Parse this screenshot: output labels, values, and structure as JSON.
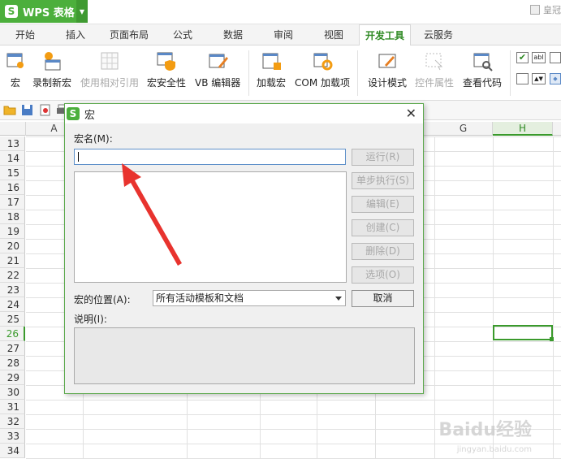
{
  "app": {
    "logo_letter": "S",
    "title": "WPS 表格",
    "user_label": "皇冠"
  },
  "tabs": [
    {
      "label": "开始"
    },
    {
      "label": "插入"
    },
    {
      "label": "页面布局"
    },
    {
      "label": "公式"
    },
    {
      "label": "数据"
    },
    {
      "label": "审阅"
    },
    {
      "label": "视图"
    },
    {
      "label": "开发工具",
      "active": true
    },
    {
      "label": "云服务"
    }
  ],
  "ribbon": {
    "macro": "宏",
    "record_macro": "录制新宏",
    "relative_ref": "使用相对引用",
    "macro_security": "宏安全性",
    "vb_editor": "VB 编辑器",
    "load_macro": "加载宏",
    "com_addins": "COM 加载项",
    "design_mode": "设计模式",
    "control_props": "控件属性",
    "view_code": "查看代码"
  },
  "sheet": {
    "columns": [
      "A",
      "G",
      "H"
    ],
    "rows": [
      "13",
      "14",
      "15",
      "16",
      "17",
      "18",
      "19",
      "20",
      "21",
      "22",
      "23",
      "24",
      "25",
      "26",
      "27",
      "28",
      "29",
      "30",
      "31",
      "32",
      "33",
      "34"
    ],
    "active_row": "26",
    "active_column": "H"
  },
  "dialog": {
    "logo_letter": "S",
    "title": "宏",
    "macro_name_label": "宏名(M):",
    "macro_name_value": "",
    "buttons": {
      "run": "运行(R)",
      "step": "单步执行(S)",
      "edit": "编辑(E)",
      "create": "创建(C)",
      "delete": "删除(D)",
      "options": "选项(O)",
      "cancel": "取消"
    },
    "location_label": "宏的位置(A):",
    "location_value": "所有活动模板和文档",
    "description_label": "说明(I):",
    "close_glyph": "✕"
  },
  "watermark": {
    "text": "Baidu经验",
    "url": "jingyan.baidu.com"
  },
  "colors": {
    "brand_green": "#4caf3c",
    "annotation_red": "#e8332e",
    "input_border": "#5e90c9"
  }
}
